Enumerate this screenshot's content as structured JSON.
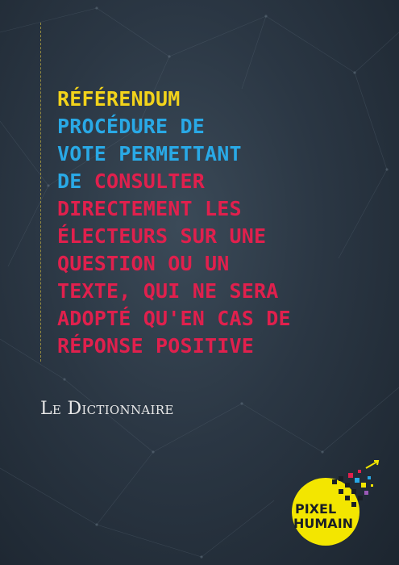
{
  "definition": {
    "term": "RÉFÉRENDUM",
    "line2": "PROCÉDURE DE",
    "line3": "VOTE PERMETTANT",
    "line4_blue": "DE",
    "line4_red": "CONSULTER",
    "line5": "DIRECTEMENT LES",
    "line6": "ÉLECTEURS SUR UNE",
    "line7": "QUESTION OU UN",
    "line8": "TEXTE, QUI NE SERA",
    "line9": "ADOPTÉ QU'EN CAS DE",
    "line10": "RÉPONSE POSITIVE"
  },
  "source": "Le Dictionnaire",
  "logo": {
    "line1": "PIXEL",
    "line2": "HUMAIN"
  },
  "colors": {
    "term": "#f2d31b",
    "definition_start": "#29a9e6",
    "definition_rest": "#e0204d",
    "background": "#2b3744",
    "logo_yellow": "#f3e600"
  }
}
